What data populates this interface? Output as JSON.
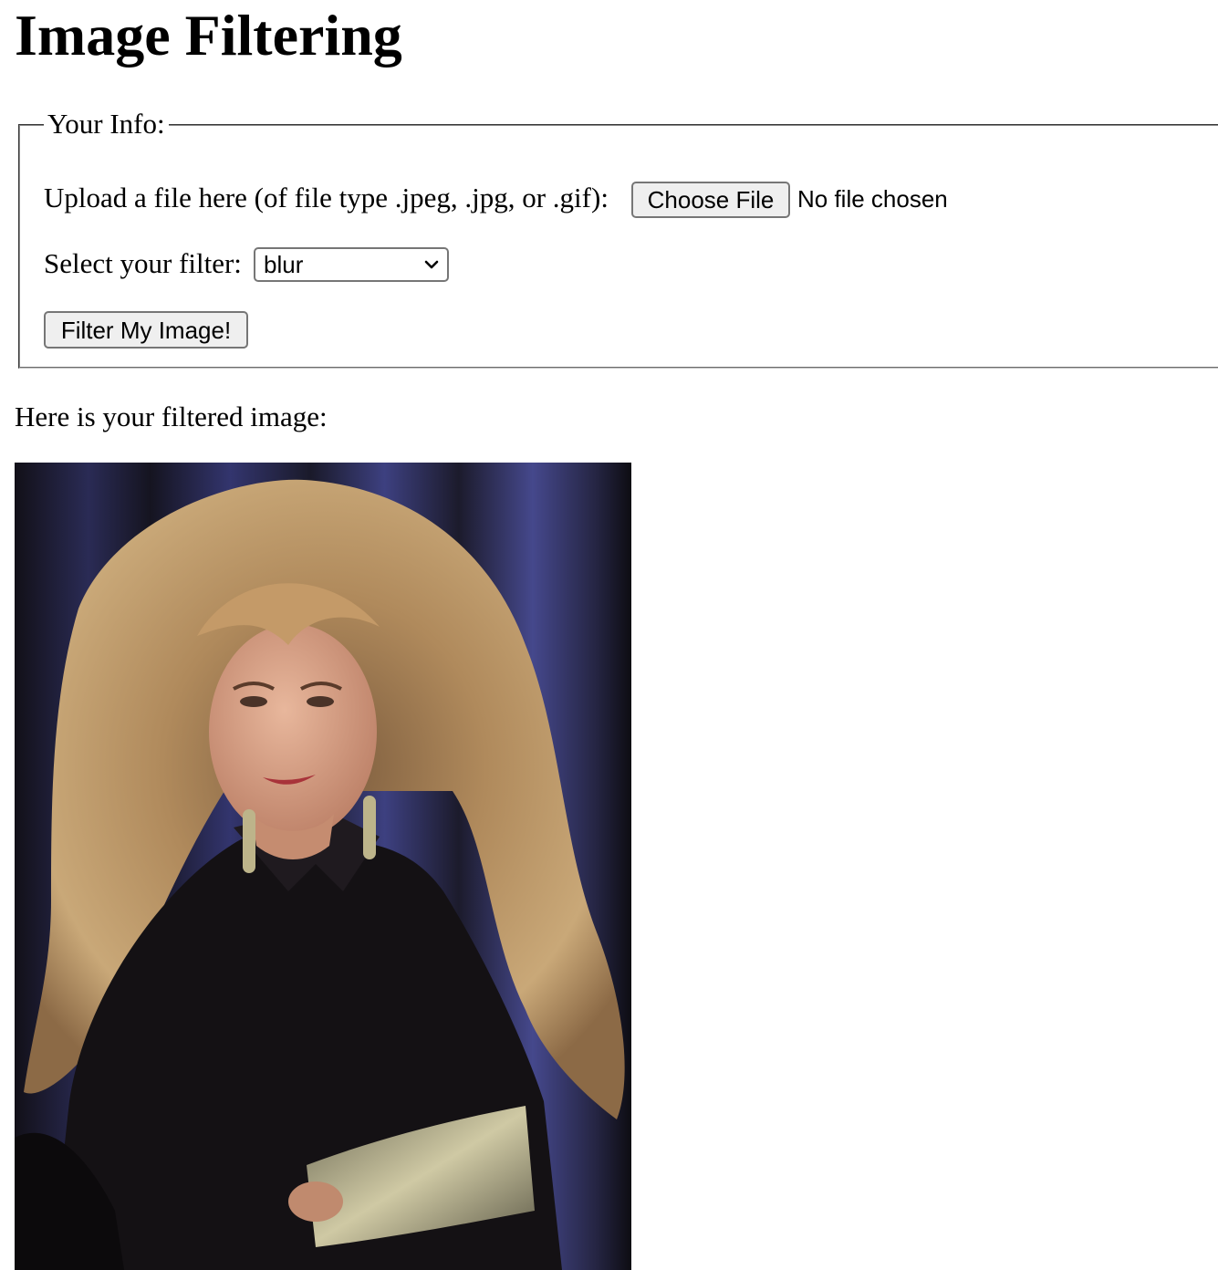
{
  "page": {
    "title": "Image Filtering"
  },
  "form": {
    "legend": "Your Info:",
    "upload_label": "Upload a file here (of file type .jpeg, .jpg, or .gif):",
    "choose_file_label": "Choose File",
    "file_status": "No file chosen",
    "filter_label": "Select your filter:",
    "filter_selected": "blur",
    "submit_label": "Filter My Image!"
  },
  "result": {
    "caption": "Here is your filtered image:",
    "image_description_icon": "portrait-photo"
  },
  "colors": {
    "button_bg": "#efefef",
    "border": "#767676",
    "curtain_blue": "#3a3d78",
    "hair": "#b08a5c"
  }
}
